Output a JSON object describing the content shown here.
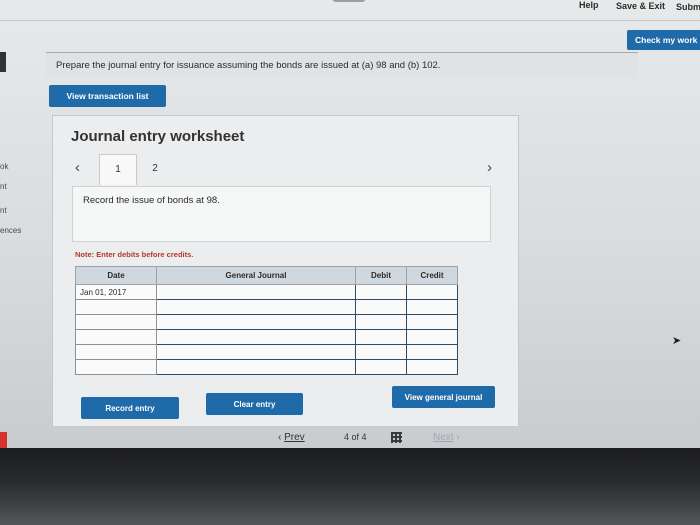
{
  "topbar": {
    "help": "Help",
    "save_exit": "Save & Exit",
    "submit": "Subm"
  },
  "left_rail": [
    "ok",
    "nt",
    "nt",
    "ences"
  ],
  "check_my_work": "Check my work",
  "instructions": "Prepare the journal entry for issuance assuming the bonds are issued at (a) 98 and (b) 102.",
  "view_transaction_list": "View transaction list",
  "worksheet": {
    "title": "Journal entry worksheet",
    "tabs": [
      "1",
      "2"
    ],
    "description": "Record the issue of bonds at 98.",
    "note": "Note: Enter debits before credits.",
    "table": {
      "headers": [
        "Date",
        "General Journal",
        "Debit",
        "Credit"
      ],
      "rows": [
        [
          "Jan 01, 2017",
          "",
          "",
          ""
        ],
        [
          "",
          "",
          "",
          ""
        ],
        [
          "",
          "",
          "",
          ""
        ],
        [
          "",
          "",
          "",
          ""
        ],
        [
          "",
          "",
          "",
          ""
        ],
        [
          "",
          "",
          "",
          ""
        ]
      ]
    },
    "record_entry": "Record entry",
    "clear_entry": "Clear entry",
    "view_general_journal": "View general journal"
  },
  "pager": {
    "prev_arrow": "‹",
    "prev": "Prev",
    "page_info": "4 of 4",
    "next": "Next",
    "next_arrow": "›"
  },
  "colors": {
    "primary_button": "#1f6aa8",
    "note_text": "#b03a2e"
  }
}
